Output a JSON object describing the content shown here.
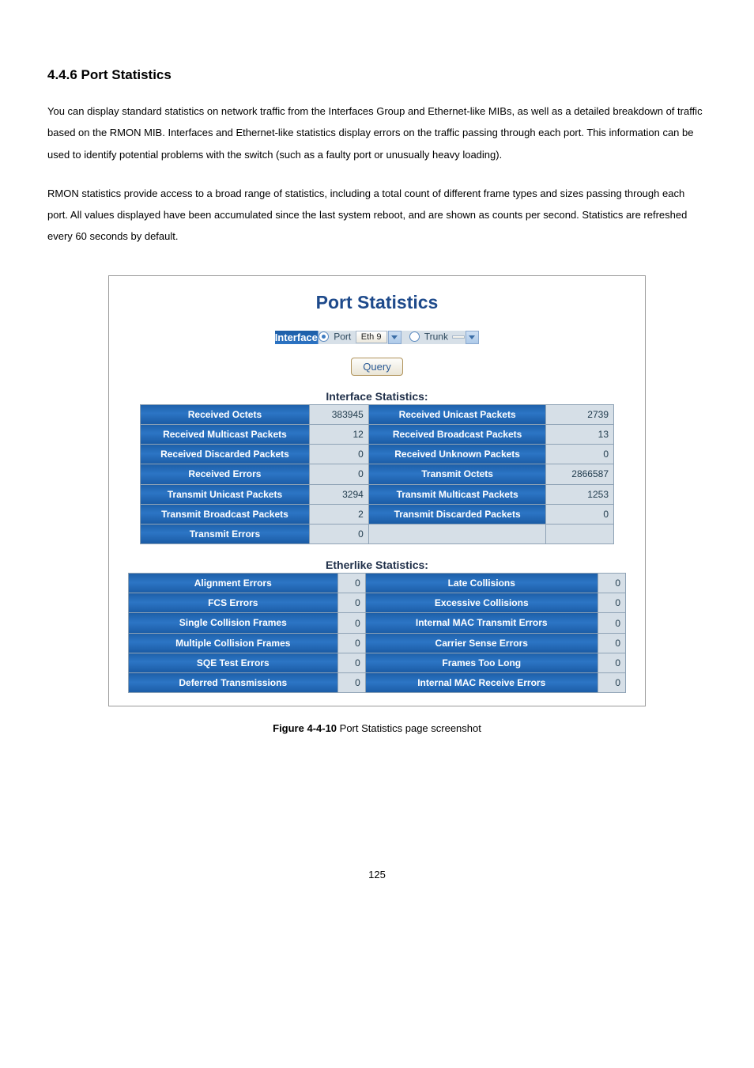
{
  "heading": "4.4.6 Port Statistics",
  "para1": "You can display standard statistics on network traffic from the Interfaces Group and Ethernet-like MIBs, as well as a detailed breakdown of traffic based on the RMON MIB. Interfaces and Ethernet-like statistics display errors on the traffic passing through each port. This information can be used to identify potential problems with the switch (such as a faulty port or unusually heavy loading).",
  "para2": "RMON statistics provide access to a broad range of statistics, including a total count of different frame types and sizes passing through each port. All values displayed have been accumulated since the last system reboot, and are shown as counts per second. Statistics are refreshed every 60 seconds by default.",
  "figure": {
    "title": "Port Statistics",
    "bar": {
      "label": "Interface",
      "port_label": "Port",
      "port_select": "Eth 9",
      "trunk_label": "Trunk",
      "trunk_select": ""
    },
    "query_btn": "Query",
    "iface_title": "Interface Statistics:",
    "iface": {
      "r1l": "Received Octets",
      "r1v": "383945",
      "r1r": "Received Unicast Packets",
      "r1rv": "2739",
      "r2l": "Received Multicast Packets",
      "r2v": "12",
      "r2r": "Received Broadcast Packets",
      "r2rv": "13",
      "r3l": "Received Discarded Packets",
      "r3v": "0",
      "r3r": "Received Unknown Packets",
      "r3rv": "0",
      "r4l": "Received Errors",
      "r4v": "0",
      "r4r": "Transmit Octets",
      "r4rv": "2866587",
      "r5l": "Transmit Unicast Packets",
      "r5v": "3294",
      "r5r": "Transmit Multicast Packets",
      "r5rv": "1253",
      "r6l": "Transmit Broadcast Packets",
      "r6v": "2",
      "r6r": "Transmit Discarded Packets",
      "r6rv": "0",
      "r7l": "Transmit Errors",
      "r7v": "0"
    },
    "ether_title": "Etherlike Statistics:",
    "ether": {
      "r1l": "Alignment Errors",
      "r1v": "0",
      "r1r": "Late Collisions",
      "r1rv": "0",
      "r2l": "FCS Errors",
      "r2v": "0",
      "r2r": "Excessive Collisions",
      "r2rv": "0",
      "r3l": "Single Collision Frames",
      "r3v": "0",
      "r3r": "Internal MAC Transmit Errors",
      "r3rv": "0",
      "r4l": "Multiple Collision Frames",
      "r4v": "0",
      "r4r": "Carrier Sense Errors",
      "r4rv": "0",
      "r5l": "SQE Test Errors",
      "r5v": "0",
      "r5r": "Frames Too Long",
      "r5rv": "0",
      "r6l": "Deferred Transmissions",
      "r6v": "0",
      "r6r": "Internal MAC Receive Errors",
      "r6rv": "0"
    }
  },
  "caption_bold": "Figure 4-4-10",
  "caption_rest": " Port Statistics page screenshot",
  "page_num": "125"
}
